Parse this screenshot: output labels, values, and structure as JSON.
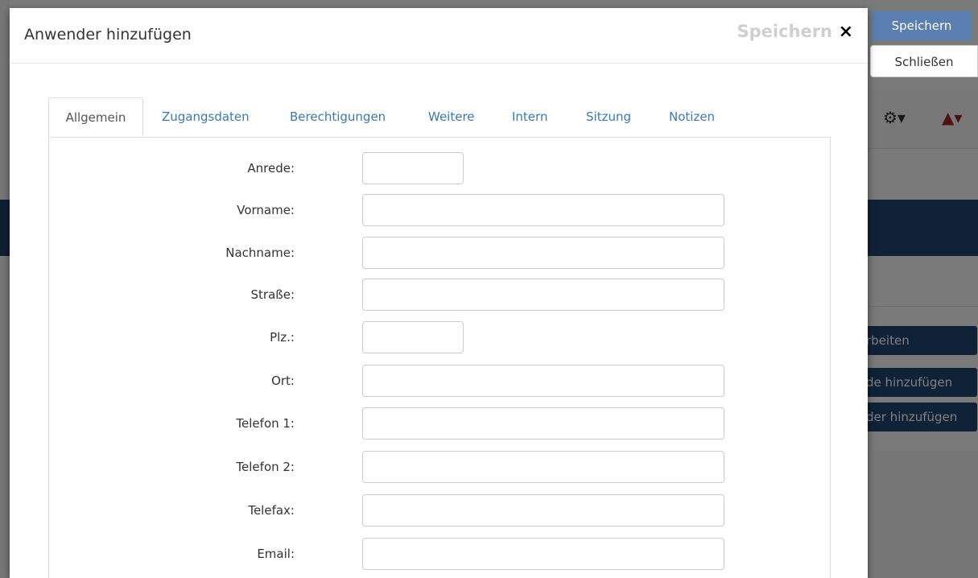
{
  "modal": {
    "title": "Anwender hinzufügen",
    "header_save": "Speichern",
    "header_close": "×"
  },
  "actions": {
    "save": "Speichern",
    "close": "Schließen"
  },
  "tabs": [
    {
      "label": "Allgemein",
      "active": true
    },
    {
      "label": "Zugangsdaten",
      "active": false
    },
    {
      "label": "Berechtigungen",
      "active": false
    },
    {
      "label": "Weitere",
      "active": false
    },
    {
      "label": "Intern",
      "active": false
    },
    {
      "label": "Sitzung",
      "active": false
    },
    {
      "label": "Notizen",
      "active": false
    }
  ],
  "form": {
    "fields": [
      {
        "label": "Anrede:",
        "value": ""
      },
      {
        "label": "Vorname:",
        "value": ""
      },
      {
        "label": "Nachname:",
        "value": ""
      },
      {
        "label": "Straße:",
        "value": ""
      },
      {
        "label": "Plz.:",
        "value": ""
      },
      {
        "label": "Ort:",
        "value": ""
      },
      {
        "label": "Telefon 1:",
        "value": ""
      },
      {
        "label": "Telefon 2:",
        "value": ""
      },
      {
        "label": "Telefax:",
        "value": ""
      },
      {
        "label": "Email:",
        "value": ""
      }
    ]
  },
  "background": {
    "buttons": [
      "rbeiten",
      "de hinzufügen",
      "der hinzufügen"
    ],
    "icons": [
      "gear-icon",
      "warning-icon"
    ],
    "colors": {
      "primary": "#1f4470",
      "link": "#3a78b5",
      "save_button": "#5a7fb0",
      "warning": "#a02020"
    }
  }
}
